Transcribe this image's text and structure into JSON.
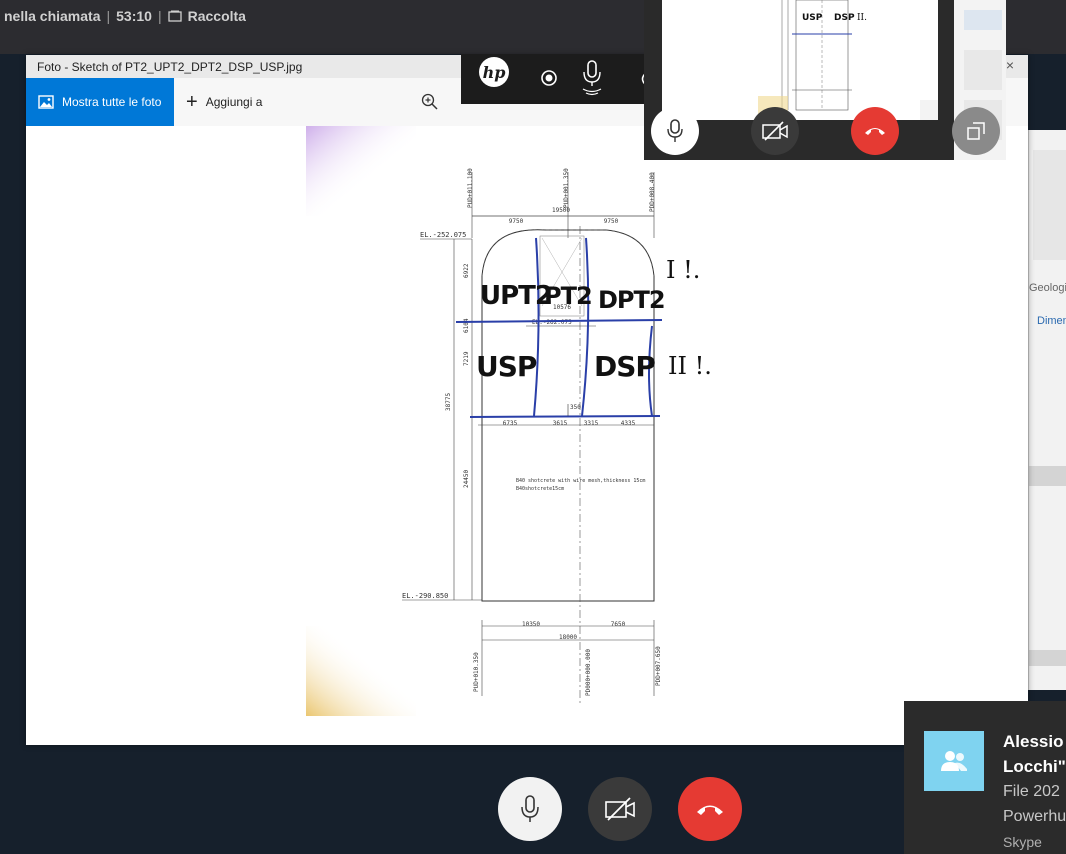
{
  "topbar": {
    "call_status": "nella chiamata",
    "separator": "|",
    "call_timer": "53:10",
    "collection_label": "Raccolta"
  },
  "photos": {
    "title": "Foto - Sketch of PT2_UPT2_DPT2_DSP_USP.jpg",
    "close_glyph": "×",
    "show_all_label": "Mostra tutte le foto",
    "add_to_label": "Aggiungi a"
  },
  "background_app": {
    "label_1": "Geologi",
    "label_2": "Dimen"
  },
  "sketch": {
    "dims_top": [
      "9750",
      "19500",
      "9750"
    ],
    "chainages_top": [
      "PUD+011.100",
      "PUD+001.350",
      "PDD+008.400"
    ],
    "el_top": "EL.-252.075",
    "el_mid": "EL.-262.075",
    "el_bottom": "EL.-290.850",
    "vertical_dims": [
      "6922",
      "6104",
      "7219",
      "38775",
      "24450"
    ],
    "mid_dims": [
      "6735",
      "3615",
      "3315",
      "4335"
    ],
    "inner_dim_350": "350",
    "inner_dim_10576": "10576",
    "shotcrete_note_1": "B40 shotcrete with wire mesh,thickness 15cm",
    "shotcrete_note_2": "B40shotcrete15cm",
    "bottom_dims": [
      "10350",
      "7650"
    ],
    "bottom_total": "18000",
    "chainages_bottom": [
      "PUD+010.350",
      "PD000+000.000",
      "PDD+007.650"
    ],
    "hand_labels": {
      "upt2": "UPT2",
      "pt2": "PT2",
      "dpt2": "DPT2",
      "usp": "USP",
      "dsp": "DSP",
      "phase_1": "I !.",
      "phase_2": "II !."
    }
  },
  "preview_sketch": {
    "usp": "USP",
    "dsp": "DSP",
    "phase": "II."
  },
  "toast": {
    "name_line1": "Alessio",
    "name_line2": "Locchi\"",
    "message_line1": "File 202",
    "message_line2": "Powerhu",
    "app_name": "Skype"
  },
  "colors": {
    "accent_blue": "#0078d7",
    "hangup_red": "#e53a33",
    "ink_blue": "#2a3fa8",
    "avatar_bg": "#7fd3f0"
  },
  "icons": {
    "collection": "collection-icon",
    "photos": "photos-icon",
    "zoom": "zoom-in-icon",
    "mic": "microphone-icon",
    "camera_off": "video-off-icon",
    "hangup": "hang-up-icon",
    "popout": "pop-out-icon",
    "record": "record-icon",
    "contacts": "contacts-icon"
  }
}
